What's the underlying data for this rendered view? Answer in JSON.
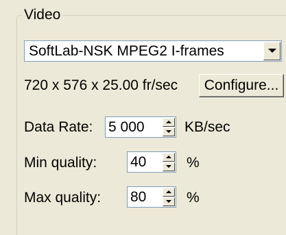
{
  "video_group": {
    "legend": "Video",
    "codec_select": {
      "value": "SoftLab-NSK MPEG2 I-frames"
    },
    "format_info": "720 x 576 x 25.00 fr/sec",
    "configure_button": "Configure...",
    "data_rate": {
      "label": "Data Rate:",
      "value": "5 000",
      "unit": "KB/sec"
    },
    "min_quality": {
      "label": "Min quality:",
      "value": "40",
      "unit": "%"
    },
    "max_quality": {
      "label": "Max quality:",
      "value": "80",
      "unit": "%"
    }
  }
}
